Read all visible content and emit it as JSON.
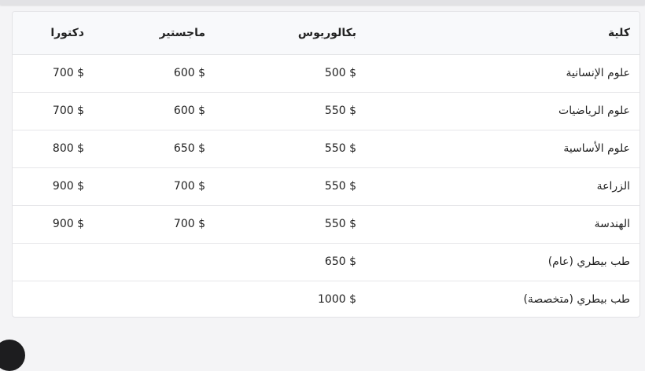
{
  "table": {
    "headers": [
      "كلية",
      "بكالوريوس",
      "ماجستير",
      "دكتورا"
    ],
    "rows": [
      [
        "علوم الإنسانية",
        "500 $",
        "600 $",
        "700 $"
      ],
      [
        "علوم الرياضيات",
        "550 $",
        "600 $",
        "700 $"
      ],
      [
        "علوم الأساسية",
        "550 $",
        "650 $",
        "800 $"
      ],
      [
        "الزراعة",
        "550 $",
        "700 $",
        "900 $"
      ],
      [
        "الهندسة",
        "550 $",
        "700 $",
        "900 $"
      ],
      [
        "طب بيطري (عام)",
        "650 $",
        "",
        ""
      ],
      [
        "طب بيطري (متخصصة)",
        "1000 $",
        "",
        ""
      ]
    ]
  }
}
